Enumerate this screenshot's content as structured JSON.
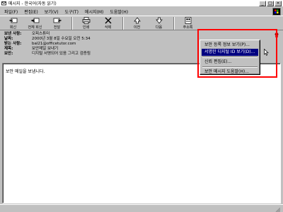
{
  "window": {
    "title": "메시지 - 한국어(자동 읽기)",
    "minimize": "_",
    "maximize": "□",
    "close": "×"
  },
  "menu": [
    "파일(F)",
    "편집(E)",
    "보기(V)",
    "도구(T)",
    "메시지(M)",
    "도움말(H)"
  ],
  "toolbar": {
    "reply": "회신",
    "reply_all": "전체 회신",
    "forward": "전달",
    "print": "인쇄",
    "delete": "삭제",
    "previous": "이전",
    "next": "다음",
    "addresses": "주소록"
  },
  "header": {
    "from_label": "보낸 사람:",
    "from_value": "오피스튜터",
    "date_label": "날짜:",
    "date_value": "2000년 3월 8일 수요일 오전 5:34",
    "to_label": "받는 사람:",
    "to_value": "bal21@officetutor.com",
    "subject_label": "제목:",
    "subject_value": "보안메일 보내기",
    "security_label": "보안:",
    "security_value": "디지털 서명되어 있음 그리고 검증됨"
  },
  "body": {
    "text": "보안 메일을 보냅니다."
  },
  "context_menu": {
    "items": [
      {
        "label": "보안 등록 정보 보기(P)...",
        "selected": false
      },
      {
        "label": "서명한 디지털 ID 보기(D)...",
        "selected": true
      },
      {
        "label": "신뢰 편집(E)...",
        "selected": false
      },
      {
        "label": "보안 메시지 도움말(H)...",
        "selected": false
      }
    ]
  },
  "colors": {
    "highlight": "#000080",
    "annotation": "#ff0000"
  }
}
